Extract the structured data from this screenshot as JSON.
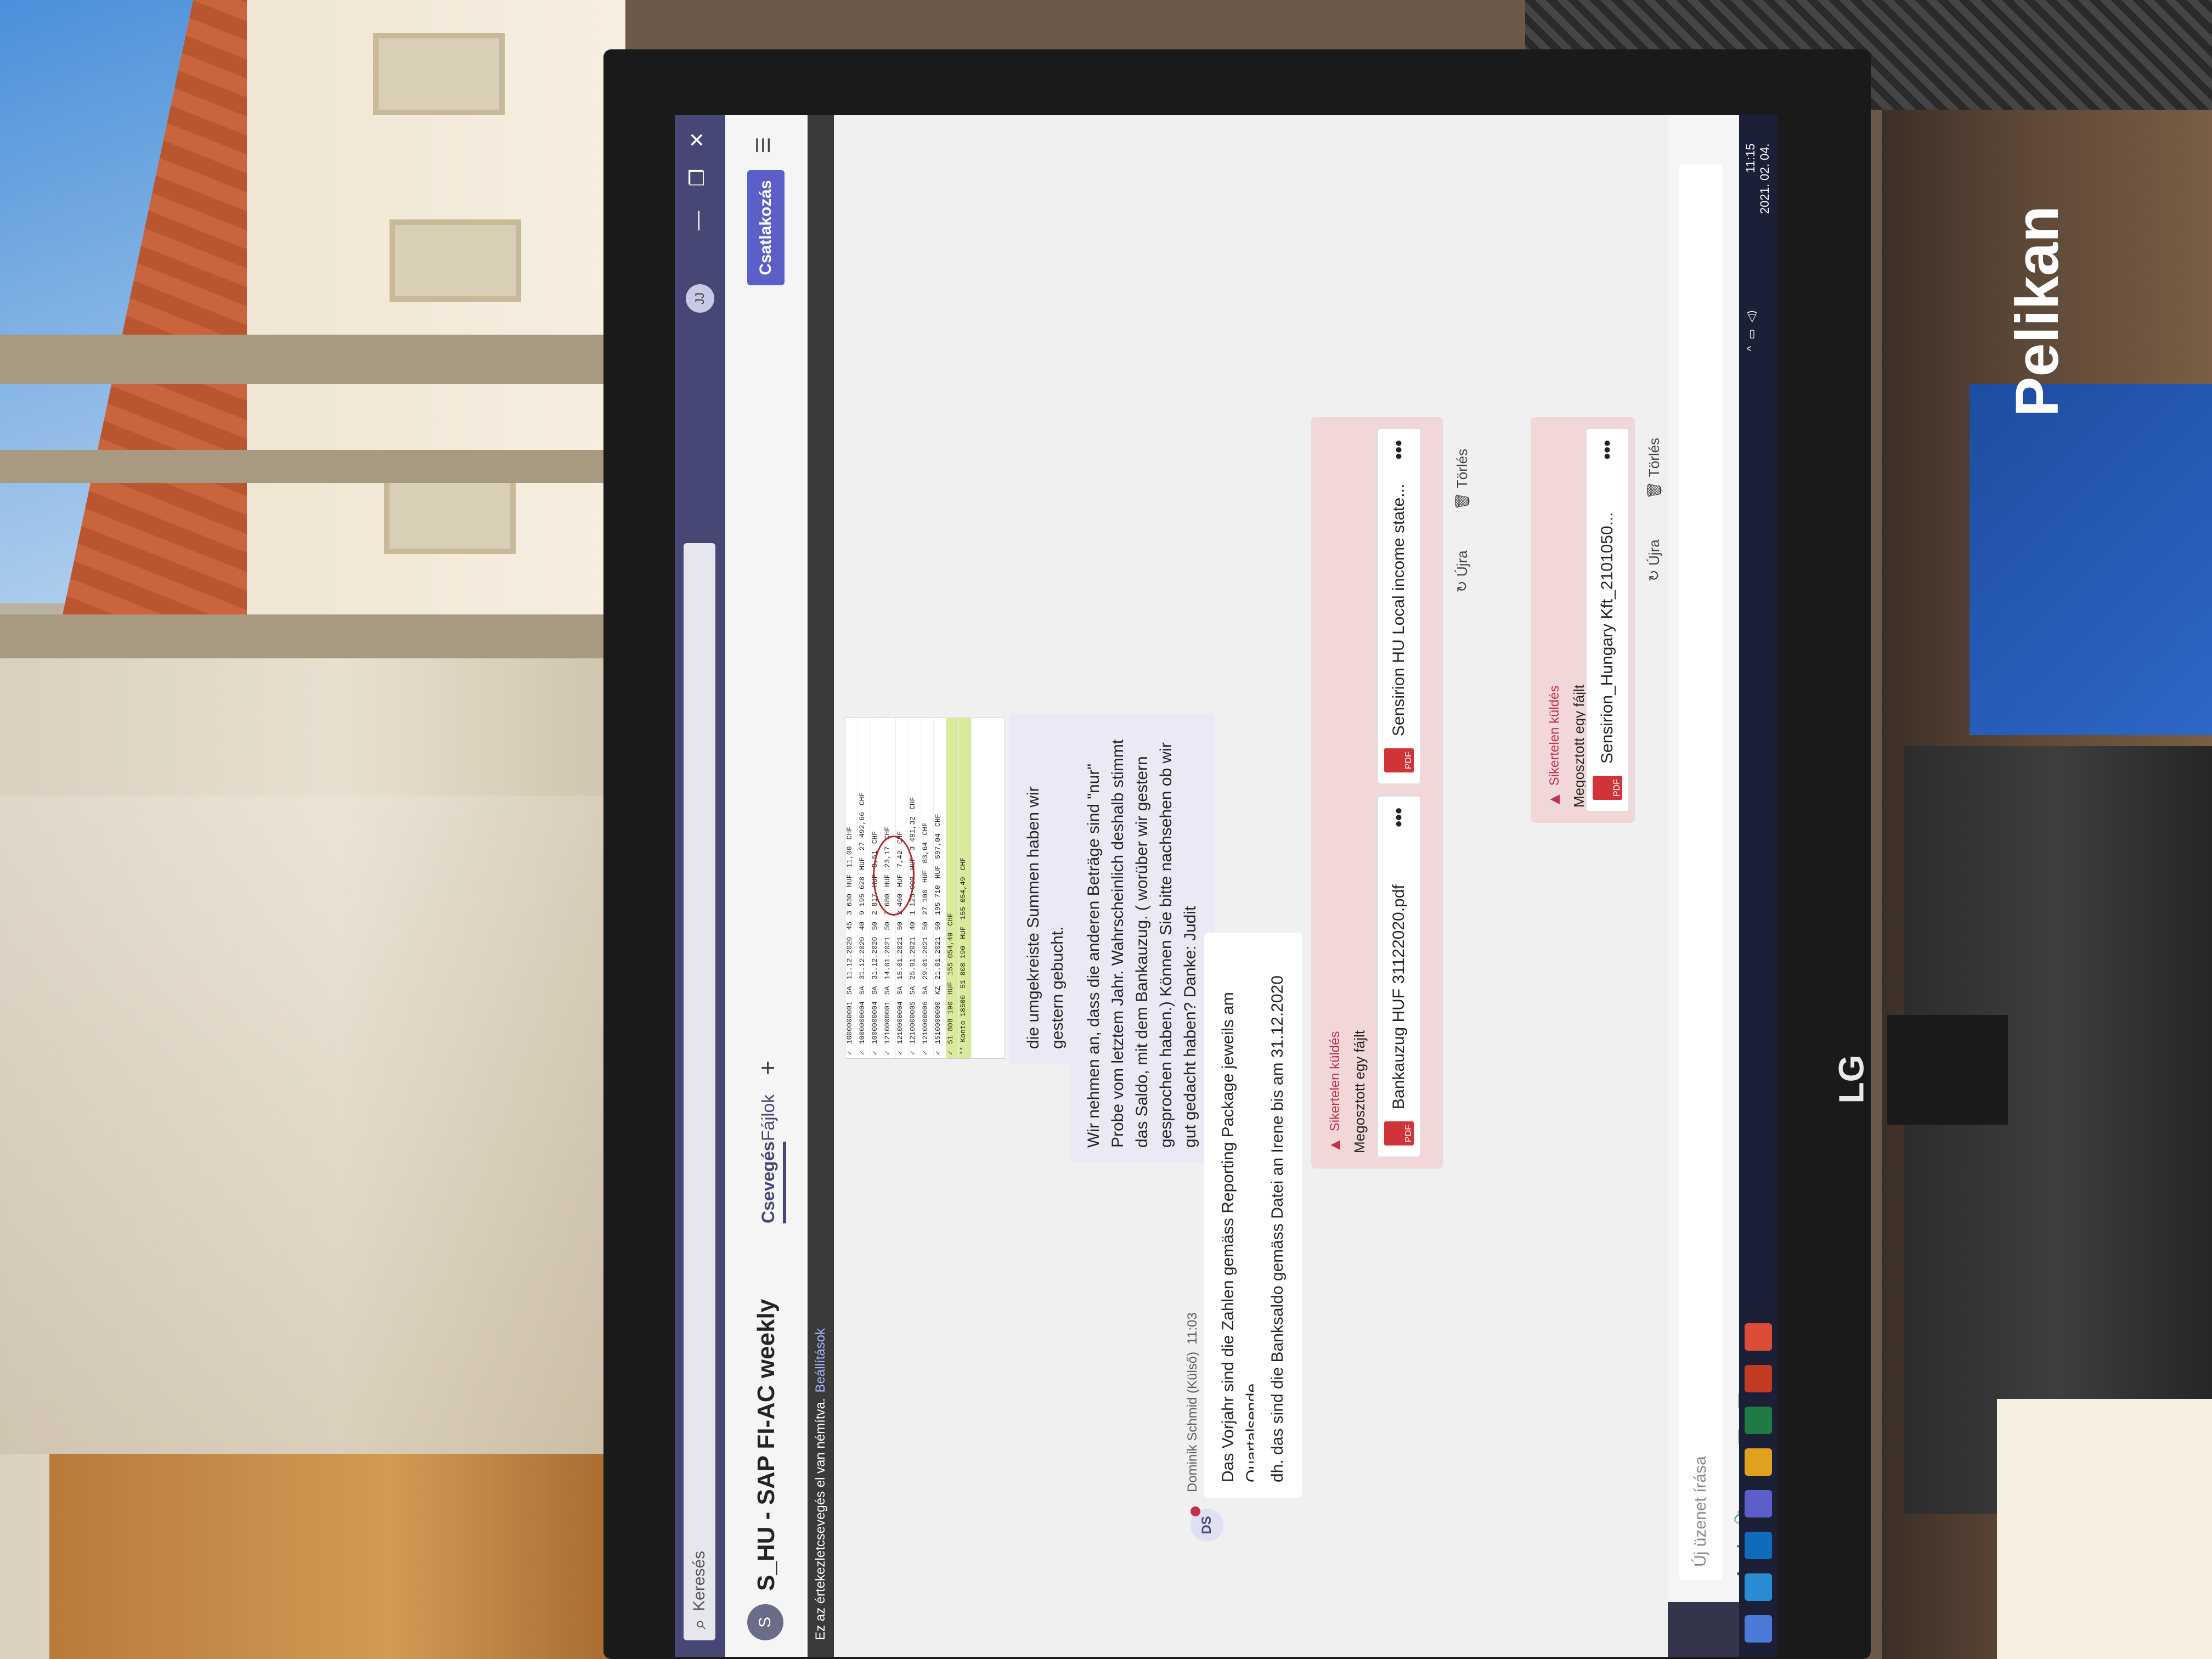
{
  "app": {
    "search_placeholder": "Keresés",
    "user_initials": "JJ",
    "window_controls": [
      "—",
      "❐",
      "✕"
    ]
  },
  "chat": {
    "icon_initials": "S",
    "title": "S_HU - SAP FI-AC weekly",
    "tabs": [
      "Csevegés",
      "Fájlok"
    ],
    "add_tab": "+",
    "meet_button": "Csatlakozás",
    "notice": "Ez az értekezletcsevegés el van némítva.",
    "notice_link": "Beállítások"
  },
  "sheet": {
    "rows": [
      [
        "✓",
        "1000000001",
        "SA",
        "11.12.2020",
        "45",
        "3 630",
        "HUF",
        "11,00",
        "CHF"
      ],
      [
        "✓",
        "1000000004",
        "SA",
        "31.12.2020",
        "40",
        "9 195 628",
        "HUF",
        "27 492,66",
        "CHF"
      ],
      [
        "✓",
        "1000000004",
        "SA",
        "31.12.2020",
        "50",
        "2 817",
        "HUF",
        "8,51",
        "CHF"
      ],
      [
        "✓",
        "1210000001",
        "SA",
        "14.01.2021",
        "50",
        "7 680",
        "HUF",
        "23,17",
        "CHF"
      ],
      [
        "✓",
        "1210000004",
        "SA",
        "15.01.2021",
        "50",
        "2 460",
        "HUF",
        "7,42",
        "CHF"
      ],
      [
        "✓",
        "1210000005",
        "SA",
        "25.01.2021",
        "40",
        "1 125 000",
        "HUF",
        "3 491,32",
        "CHF"
      ],
      [
        "✓",
        "1210000006",
        "SA",
        "29.01.2021",
        "50",
        "27 100",
        "HUF",
        "83,64",
        "CHF"
      ],
      [
        "✓",
        "1510000000",
        "KZ",
        "21.01.2021",
        "50",
        "195 710",
        "HUF",
        "597,04",
        "CHF"
      ]
    ],
    "subtotal": [
      "✓",
      "51 808 190",
      "HUF",
      "155 054,49",
      "CHF"
    ],
    "total": [
      "** Konto 18500",
      "51 808 190",
      "HUF",
      "155 054,49",
      "CHF"
    ]
  },
  "messages": {
    "self_1": "die umgekreiste Summen haben wir gestern gebucht.",
    "self_2": "Wir nehmen an, dass die anderen Beträge sind \"nur\" Probe vom letztem Jahr. Wahrscheinlich deshalb stimmt das Saldo, mit dem Bankauzug. ( worüber wir gestern gesprochen haben.) Können Sie bitte nachsehen ob wir gut gedacht haben? Danke: Judit",
    "other_author": "Dominik Schmid (Külső)",
    "other_time": "11:03",
    "other_initials": "DS",
    "other_1": "Das Vorjahr sind die Zahlen gemäss Reporting Package jeweils am Quartalsende...",
    "other_2": "dh. das sind die Banksaldo gemäss Datei an Irene bis am 31.12.2020",
    "failed_label": "Sikertelen küldés",
    "shared_label": "Megosztott egy fájlt",
    "retry": "Újra",
    "delete": "Törlés",
    "file_1": "Bankauzug HUF 31122020.pdf",
    "file_2": "Sensirion HU Local income state...",
    "file_3": "Sensirion_Hungary Kft_2101050...",
    "more": "•••"
  },
  "compose": {
    "placeholder": "Új üzenet írása"
  },
  "taskbar": {
    "time": "11:15",
    "date": "2021. 02. 04."
  },
  "photo": {
    "monitor_brand": "LG",
    "box_brand": "Pelikan"
  }
}
